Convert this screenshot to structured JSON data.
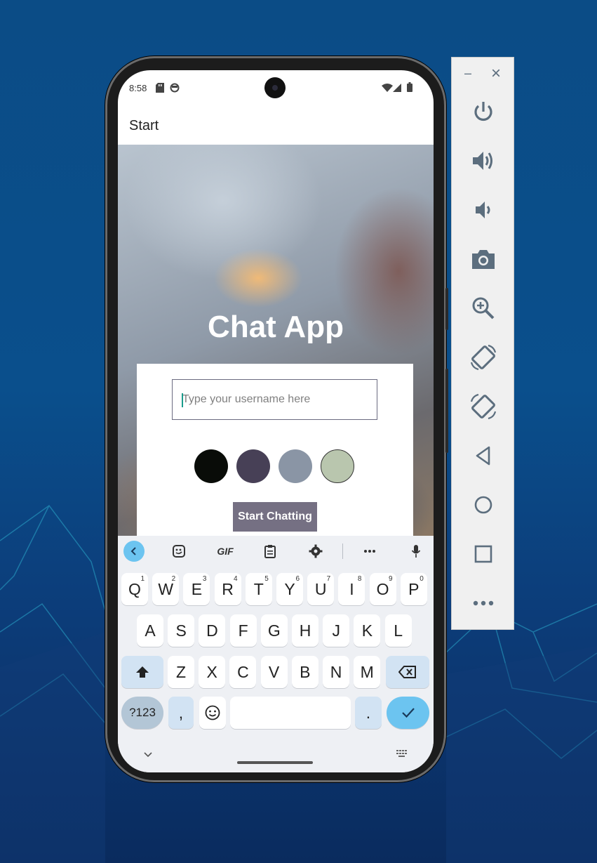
{
  "status_bar": {
    "time": "8:58"
  },
  "app_bar": {
    "title": "Start"
  },
  "hero": {
    "title": "Chat App"
  },
  "form": {
    "username_placeholder": "Type your username here",
    "username_value": "",
    "color_options": [
      "#090C08",
      "#474056",
      "#8A95A5",
      "#B9C6AE"
    ],
    "start_button_label": "Start Chatting"
  },
  "keyboard": {
    "toolbar_items": [
      "back-icon",
      "sticker-icon",
      "GIF",
      "clipboard-icon",
      "gear-icon",
      "more-icon",
      "mic-icon"
    ],
    "gif_label": "GIF",
    "row1": [
      {
        "k": "Q",
        "s": "1"
      },
      {
        "k": "W",
        "s": "2"
      },
      {
        "k": "E",
        "s": "3"
      },
      {
        "k": "R",
        "s": "4"
      },
      {
        "k": "T",
        "s": "5"
      },
      {
        "k": "Y",
        "s": "6"
      },
      {
        "k": "U",
        "s": "7"
      },
      {
        "k": "I",
        "s": "8"
      },
      {
        "k": "O",
        "s": "9"
      },
      {
        "k": "P",
        "s": "0"
      }
    ],
    "row2": [
      "A",
      "S",
      "D",
      "F",
      "G",
      "H",
      "J",
      "K",
      "L"
    ],
    "row3": [
      "Z",
      "X",
      "C",
      "V",
      "B",
      "N",
      "M"
    ],
    "symbols_label": "?123",
    "comma_label": ",",
    "period_label": "."
  },
  "emulator_toolbar": {
    "minimize_label": "–",
    "close_label": "×",
    "buttons": [
      "power-icon",
      "volume-up-icon",
      "volume-down-icon",
      "camera-icon",
      "zoom-icon",
      "rotate-left-icon",
      "rotate-right-icon",
      "back-icon",
      "home-icon",
      "overview-icon",
      "more-icon"
    ]
  },
  "colors": {
    "start_button": "#757083",
    "keyboard_accent": "#6cc4f0"
  }
}
